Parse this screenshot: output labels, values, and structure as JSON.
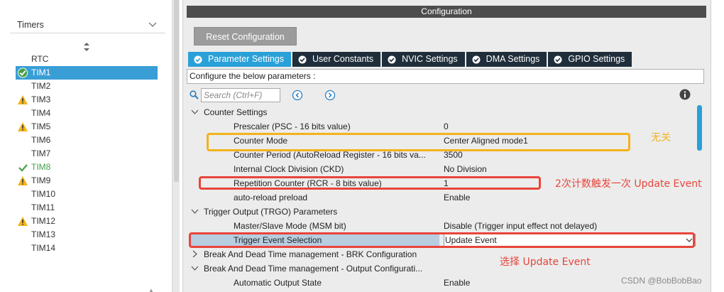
{
  "left_panel": {
    "header": "Timers",
    "items": [
      {
        "label": "RTC",
        "status": "none"
      },
      {
        "label": "TIM1",
        "status": "ok-selected"
      },
      {
        "label": "TIM2",
        "status": "none"
      },
      {
        "label": "TIM3",
        "status": "warning"
      },
      {
        "label": "TIM4",
        "status": "none"
      },
      {
        "label": "TIM5",
        "status": "warning"
      },
      {
        "label": "TIM6",
        "status": "none"
      },
      {
        "label": "TIM7",
        "status": "none"
      },
      {
        "label": "TIM8",
        "status": "ok"
      },
      {
        "label": "TIM9",
        "status": "warning"
      },
      {
        "label": "TIM10",
        "status": "none"
      },
      {
        "label": "TIM11",
        "status": "none"
      },
      {
        "label": "TIM12",
        "status": "warning"
      },
      {
        "label": "TIM13",
        "status": "none"
      },
      {
        "label": "TIM14",
        "status": "none"
      }
    ]
  },
  "config": {
    "title": "Configuration",
    "reset_label": "Reset Configuration",
    "tabs": [
      {
        "label": "Parameter Settings",
        "active": true
      },
      {
        "label": "User Constants",
        "active": false
      },
      {
        "label": "NVIC Settings",
        "active": false
      },
      {
        "label": "DMA Settings",
        "active": false
      },
      {
        "label": "GPIO Settings",
        "active": false
      }
    ],
    "description": "Configure the below parameters :",
    "search_placeholder": "Search (Ctrl+F)"
  },
  "params": [
    {
      "type": "group",
      "label": "Counter Settings",
      "expanded": true
    },
    {
      "type": "param",
      "name": "Prescaler (PSC - 16 bits value)",
      "value": "0"
    },
    {
      "type": "param",
      "name": "Counter Mode",
      "value": "Center Aligned mode1"
    },
    {
      "type": "param",
      "name": "Counter Period (AutoReload Register - 16 bits va...",
      "value": "3500"
    },
    {
      "type": "param",
      "name": "Internal Clock Division (CKD)",
      "value": "No Division"
    },
    {
      "type": "param",
      "name": "Repetition Counter (RCR - 8 bits value)",
      "value": "1"
    },
    {
      "type": "param",
      "name": "auto-reload preload",
      "value": "Enable"
    },
    {
      "type": "group",
      "label": "Trigger Output (TRGO) Parameters",
      "expanded": true
    },
    {
      "type": "param",
      "name": "Master/Slave Mode (MSM bit)",
      "value": "Disable (Trigger input effect not delayed)"
    },
    {
      "type": "param",
      "name": "Trigger Event Selection",
      "value": "Update Event",
      "selected": true
    },
    {
      "type": "group",
      "label": "Break And Dead Time management - BRK Configuration",
      "expanded": false
    },
    {
      "type": "group",
      "label": "Break And Dead Time management - Output Configurati...",
      "expanded": true
    },
    {
      "type": "param",
      "name": "Automatic Output State",
      "value": "Enable"
    }
  ],
  "annotations": {
    "counter_mode_note": "无关",
    "repetition_note": "2次计数触发一次 Update Event",
    "trigger_note": "选择 Update Event"
  },
  "watermark": "CSDN @BobBobBao",
  "colors": {
    "tab_active": "#2aa0d8",
    "tab_inactive": "#1f2e3a",
    "selected_row": "#3a9ed6",
    "warning": "#f3b31c",
    "ok": "#44a04a",
    "annotation_red": "#e8443a",
    "annotation_yellow": "#f3b31c"
  }
}
